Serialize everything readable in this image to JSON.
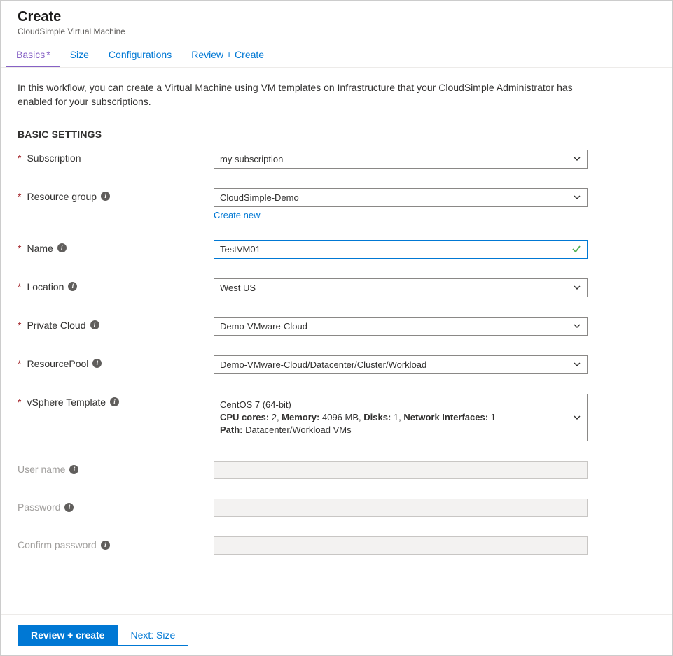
{
  "header": {
    "title": "Create",
    "subtitle": "CloudSimple Virtual Machine"
  },
  "tabs": [
    {
      "label": "Basics",
      "required": true,
      "active": true
    },
    {
      "label": "Size",
      "required": false,
      "active": false
    },
    {
      "label": "Configurations",
      "required": false,
      "active": false
    },
    {
      "label": "Review + Create",
      "required": false,
      "active": false
    }
  ],
  "intro": "In this workflow, you can create a Virtual Machine using VM templates on Infrastructure that your CloudSimple Administrator has enabled for your subscriptions.",
  "sectionHeading": "BASIC SETTINGS",
  "fields": {
    "subscription": {
      "label": "Subscription",
      "value": "my subscription"
    },
    "resourceGroup": {
      "label": "Resource group",
      "value": "CloudSimple-Demo",
      "createNew": "Create new"
    },
    "name": {
      "label": "Name",
      "value": "TestVM01"
    },
    "location": {
      "label": "Location",
      "value": "West US"
    },
    "privateCloud": {
      "label": "Private Cloud",
      "value": "Demo-VMware-Cloud"
    },
    "resourcePool": {
      "label": "ResourcePool",
      "value": "Demo-VMware-Cloud/Datacenter/Cluster/Workload"
    },
    "template": {
      "label": "vSphere Template",
      "line1": "CentOS 7 (64-bit)",
      "specsLabels": {
        "cpu": "CPU cores:",
        "mem": "Memory:",
        "disks": "Disks:",
        "nics": "Network Interfaces:",
        "path": "Path:"
      },
      "specs": {
        "cpu": "2",
        "mem": "4096 MB",
        "disks": "1",
        "nics": "1",
        "path": "Datacenter/Workload VMs"
      }
    },
    "username": {
      "label": "User name",
      "value": ""
    },
    "password": {
      "label": "Password",
      "value": ""
    },
    "confirmPassword": {
      "label": "Confirm password",
      "value": ""
    }
  },
  "footer": {
    "review": "Review + create",
    "next": "Next: Size"
  }
}
